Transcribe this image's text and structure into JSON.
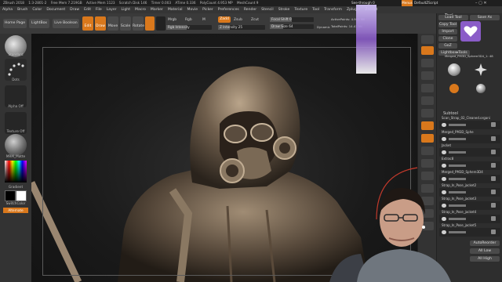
{
  "window": {
    "title_items": [
      "ZBrush 2018",
      "1:3-2801-2",
      "Free Mem 7.219GB",
      "Active Mem 1123",
      "Scratch Disk 146",
      "Timer 0.003",
      "ATime 0.336",
      "PolyCount 4.953 MP",
      "MeshCount 9"
    ],
    "quick_save": "QuickSave",
    "see_through": "See-through 0",
    "menus_label": "Menus",
    "default_script": "DefaultZScript"
  },
  "menubar": [
    "Alpha",
    "Brush",
    "Color",
    "Document",
    "Draw",
    "Edit",
    "File",
    "Layer",
    "Light",
    "Macro",
    "Marker",
    "Material",
    "Movie",
    "Picker",
    "Preferences",
    "Render",
    "Stencil",
    "Stroke",
    "Texture",
    "Tool",
    "Transform",
    "Zplugin",
    "Zscript"
  ],
  "toolbar": {
    "home_page": "Home Page",
    "lightbox": "LightBox",
    "live_boolean": "Live Boolean",
    "edit": "Edit",
    "draw": "Draw",
    "move": "Move",
    "scale": "Scale",
    "rotate": "Rotate",
    "mrgb": "Mrgb",
    "rgb": "Rgb",
    "m": "M",
    "zadd": "Zadd",
    "zsub": "Zsub",
    "zcut": "Zcut",
    "rgb_intensity": "Rgb Intensity",
    "z_intensity": "Z Intensity 25",
    "focal_shift": "Focal Shift 0",
    "draw_size": "Draw Size 64",
    "dynamic": "Dynamic",
    "active_points": "ActivePoints: 4.953 Mil",
    "total_points": "TotalPoints: 14.41 Mil"
  },
  "left_panel": {
    "brush_label": "Standard",
    "stroke_label": "Dots",
    "alpha_label": "Alpha Off",
    "texture_label": "Texture Off",
    "material_label": "MRM_Matte",
    "gradient_label": "Gradient",
    "switch_color": "SwitchColor",
    "alternate": "Alternate"
  },
  "right_icons": [
    "BPR",
    "SPix 3",
    "Scroll",
    "Zoom",
    "Actual",
    "AAHalf",
    "Dynamic Persp",
    "Floor",
    "Local",
    "Frame",
    "Move",
    "Scale",
    "Rotate",
    "Line Fill",
    "PolyF",
    "Transp",
    "Ghost",
    "Solo",
    "Xpose"
  ],
  "tool_panel": {
    "header": "Tool",
    "load_tool": "Load Tool",
    "save_as": "Save As",
    "copy_tool": "Copy Tool",
    "paste_tool": "Paste Tool",
    "import": "Import",
    "export": "Export",
    "clone": "Clone",
    "make_polymesh": "Make PolyMesh3D",
    "goz": "GoZ",
    "all": "All",
    "visible": "Visible",
    "r": "R",
    "lightbox_tools": "Lightbox▸Tools",
    "current_tool": "Merged_PM3D_Sphere3D4_1: 48",
    "tools": [
      "Merged_PM3D",
      "PolyMesh3D",
      "SimpleBrush",
      "Sphere3D",
      "Merged_PM3D"
    ],
    "subtool_header": "Subtool",
    "subtools": [
      "Scan_Strap_02_Cleaned.organi",
      "Merged_PM3D_Sphe",
      "Jacket",
      "Extrac8",
      "Merged_PM3D_Sphere3D4",
      "Strap_In_Pose_jacket2",
      "Strap_In_Pose_jacket3",
      "Strap_In_Pose_jacket4",
      "Strap_In_Pose_jacket5",
      "Strap_In_Pose_jacket7"
    ],
    "list_all": "List All",
    "auto_collapse": "AutoReorder",
    "all_low": "All Low",
    "all_high": "All High"
  },
  "colors": {
    "accent_orange": "#d9781c",
    "panel_dark": "#2e2e2e",
    "viewport_bg": "#1a1a1a",
    "highlight_purple": "#8a5cc8"
  }
}
